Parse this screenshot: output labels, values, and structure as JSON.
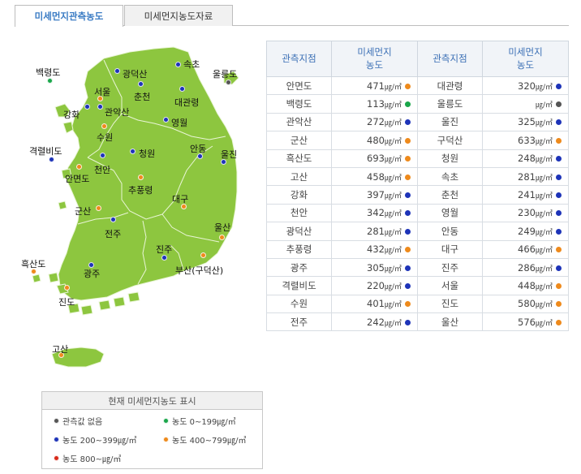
{
  "tabs": [
    "미세먼지관측농도",
    "미세먼지농도자료"
  ],
  "colors": {
    "blue": "#1e34b8",
    "orange": "#ee8a1c",
    "green": "#1aa64a",
    "gray": "#555555",
    "red": "#d82a1a",
    "land": "#8dc63f"
  },
  "map": {
    "labels": [
      {
        "name": "백령도",
        "level": "green"
      },
      {
        "name": "강화",
        "level": "blue"
      },
      {
        "name": "서울",
        "level": "orange"
      },
      {
        "name": "관악산",
        "level": "blue"
      },
      {
        "name": "광덕산",
        "level": "blue"
      },
      {
        "name": "춘천",
        "level": "blue"
      },
      {
        "name": "속초",
        "level": "blue"
      },
      {
        "name": "울릉도",
        "level": "gray"
      },
      {
        "name": "대관령",
        "level": "blue"
      },
      {
        "name": "영월",
        "level": "blue"
      },
      {
        "name": "수원",
        "level": "orange"
      },
      {
        "name": "격렬비도",
        "level": "blue"
      },
      {
        "name": "천안",
        "level": "blue"
      },
      {
        "name": "청원",
        "level": "blue"
      },
      {
        "name": "안동",
        "level": "blue"
      },
      {
        "name": "울진",
        "level": "blue"
      },
      {
        "name": "안면도",
        "level": "orange"
      },
      {
        "name": "추풍령",
        "level": "orange"
      },
      {
        "name": "대구",
        "level": "orange"
      },
      {
        "name": "군산",
        "level": "orange"
      },
      {
        "name": "전주",
        "level": "blue"
      },
      {
        "name": "울산",
        "level": "orange"
      },
      {
        "name": "진주",
        "level": "blue"
      },
      {
        "name": "부산(구덕산)",
        "level": "orange"
      },
      {
        "name": "흑산도",
        "level": "orange"
      },
      {
        "name": "광주",
        "level": "blue"
      },
      {
        "name": "진도",
        "level": "orange"
      },
      {
        "name": "고산",
        "level": "orange"
      }
    ]
  },
  "legend": {
    "title": "현재 미세먼지농도 표시",
    "items": [
      {
        "label": "관측값 없음",
        "level": "gray"
      },
      {
        "label": "농도 0~199㎍/㎥",
        "level": "green"
      },
      {
        "label": "농도 200~399㎍/㎥",
        "level": "blue"
      },
      {
        "label": "농도 400~799㎍/㎥",
        "level": "orange"
      },
      {
        "label": "농도 800~㎍/㎥",
        "level": "red"
      }
    ]
  },
  "table": {
    "headers": [
      "관측지점",
      "미세먼지\n농도",
      "관측지점",
      "미세먼지\n농도"
    ],
    "unit": "㎍/㎥",
    "rows": [
      {
        "s1": "안면도",
        "v1": "471",
        "l1": "orange",
        "s2": "대관령",
        "v2": "320",
        "l2": "blue"
      },
      {
        "s1": "백령도",
        "v1": "113",
        "l1": "green",
        "s2": "울릉도",
        "v2": "",
        "l2": "gray"
      },
      {
        "s1": "관악산",
        "v1": "272",
        "l1": "blue",
        "s2": "울진",
        "v2": "325",
        "l2": "blue"
      },
      {
        "s1": "군산",
        "v1": "480",
        "l1": "orange",
        "s2": "구덕산",
        "v2": "633",
        "l2": "orange"
      },
      {
        "s1": "흑산도",
        "v1": "693",
        "l1": "orange",
        "s2": "청원",
        "v2": "248",
        "l2": "blue"
      },
      {
        "s1": "고산",
        "v1": "458",
        "l1": "orange",
        "s2": "속초",
        "v2": "281",
        "l2": "blue"
      },
      {
        "s1": "강화",
        "v1": "397",
        "l1": "blue",
        "s2": "춘천",
        "v2": "241",
        "l2": "blue"
      },
      {
        "s1": "천안",
        "v1": "342",
        "l1": "blue",
        "s2": "영월",
        "v2": "230",
        "l2": "blue"
      },
      {
        "s1": "광덕산",
        "v1": "281",
        "l1": "blue",
        "s2": "안동",
        "v2": "249",
        "l2": "blue"
      },
      {
        "s1": "추풍령",
        "v1": "432",
        "l1": "orange",
        "s2": "대구",
        "v2": "466",
        "l2": "orange"
      },
      {
        "s1": "광주",
        "v1": "305",
        "l1": "blue",
        "s2": "진주",
        "v2": "286",
        "l2": "blue"
      },
      {
        "s1": "격렬비도",
        "v1": "220",
        "l1": "blue",
        "s2": "서울",
        "v2": "448",
        "l2": "orange"
      },
      {
        "s1": "수원",
        "v1": "401",
        "l1": "orange",
        "s2": "진도",
        "v2": "580",
        "l2": "orange"
      },
      {
        "s1": "전주",
        "v1": "242",
        "l1": "blue",
        "s2": "울산",
        "v2": "576",
        "l2": "orange"
      }
    ]
  }
}
